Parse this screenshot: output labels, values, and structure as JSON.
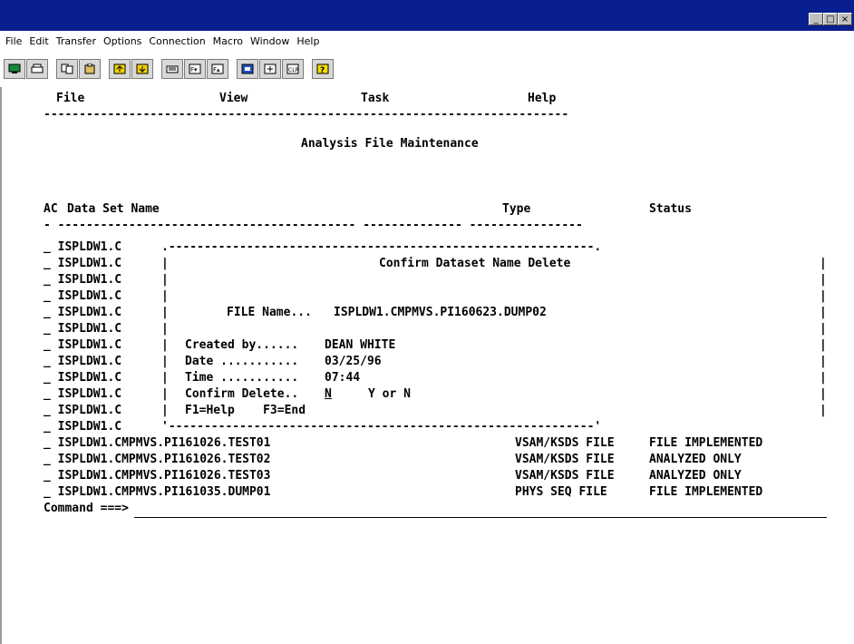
{
  "window": {
    "controls": [
      "_",
      "□",
      "×"
    ]
  },
  "menubar": [
    "File",
    "Edit",
    "Transfer",
    "Options",
    "Connection",
    "Macro",
    "Window",
    "Help"
  ],
  "terminal": {
    "action_bar": [
      "File",
      "View",
      "Task",
      "Help"
    ],
    "separator": "--------------------------------------------------------------------------",
    "title": "Analysis File Maintenance",
    "headers": {
      "ac": "AC",
      "dsn": "Data Set Name",
      "type": "Type",
      "status": "Status"
    },
    "header_underline": "- ------------------------------------------ -------------- ----------------",
    "list_prefix": "ISPLDW1.C",
    "popup": {
      "top_border": ".------------------------------------------------------------.",
      "bottom_border": "'------------------------------------------------------------'",
      "title": "Confirm Dataset Name Delete",
      "file_name_label": "FILE Name...",
      "file_name_value": "ISPLDW1.CMPMVS.PI160623.DUMP02",
      "created_by_label": "Created by......",
      "created_by_value": "DEAN WHITE",
      "date_label": "Date ...........",
      "date_value": "03/25/96",
      "time_label": "Time ...........",
      "time_value": "07:44",
      "confirm_label": "Confirm Delete..",
      "confirm_value": "N",
      "confirm_hint": "Y or N",
      "keys": "F1=Help    F3=End"
    },
    "datasets": [
      {
        "name": "ISPLDW1.CMPMVS.PI161026.TEST01",
        "type": "VSAM/KSDS FILE",
        "status": "FILE IMPLEMENTED"
      },
      {
        "name": "ISPLDW1.CMPMVS.PI161026.TEST02",
        "type": "VSAM/KSDS FILE",
        "status": "ANALYZED ONLY"
      },
      {
        "name": "ISPLDW1.CMPMVS.PI161026.TEST03",
        "type": "VSAM/KSDS FILE",
        "status": "ANALYZED ONLY"
      },
      {
        "name": "ISPLDW1.CMPMVS.PI161035.DUMP01",
        "type": "PHYS SEQ FILE",
        "status": "FILE IMPLEMENTED"
      }
    ],
    "command_label": "Command ===>"
  },
  "colors": {
    "titlebar": "#0a1f8f"
  }
}
